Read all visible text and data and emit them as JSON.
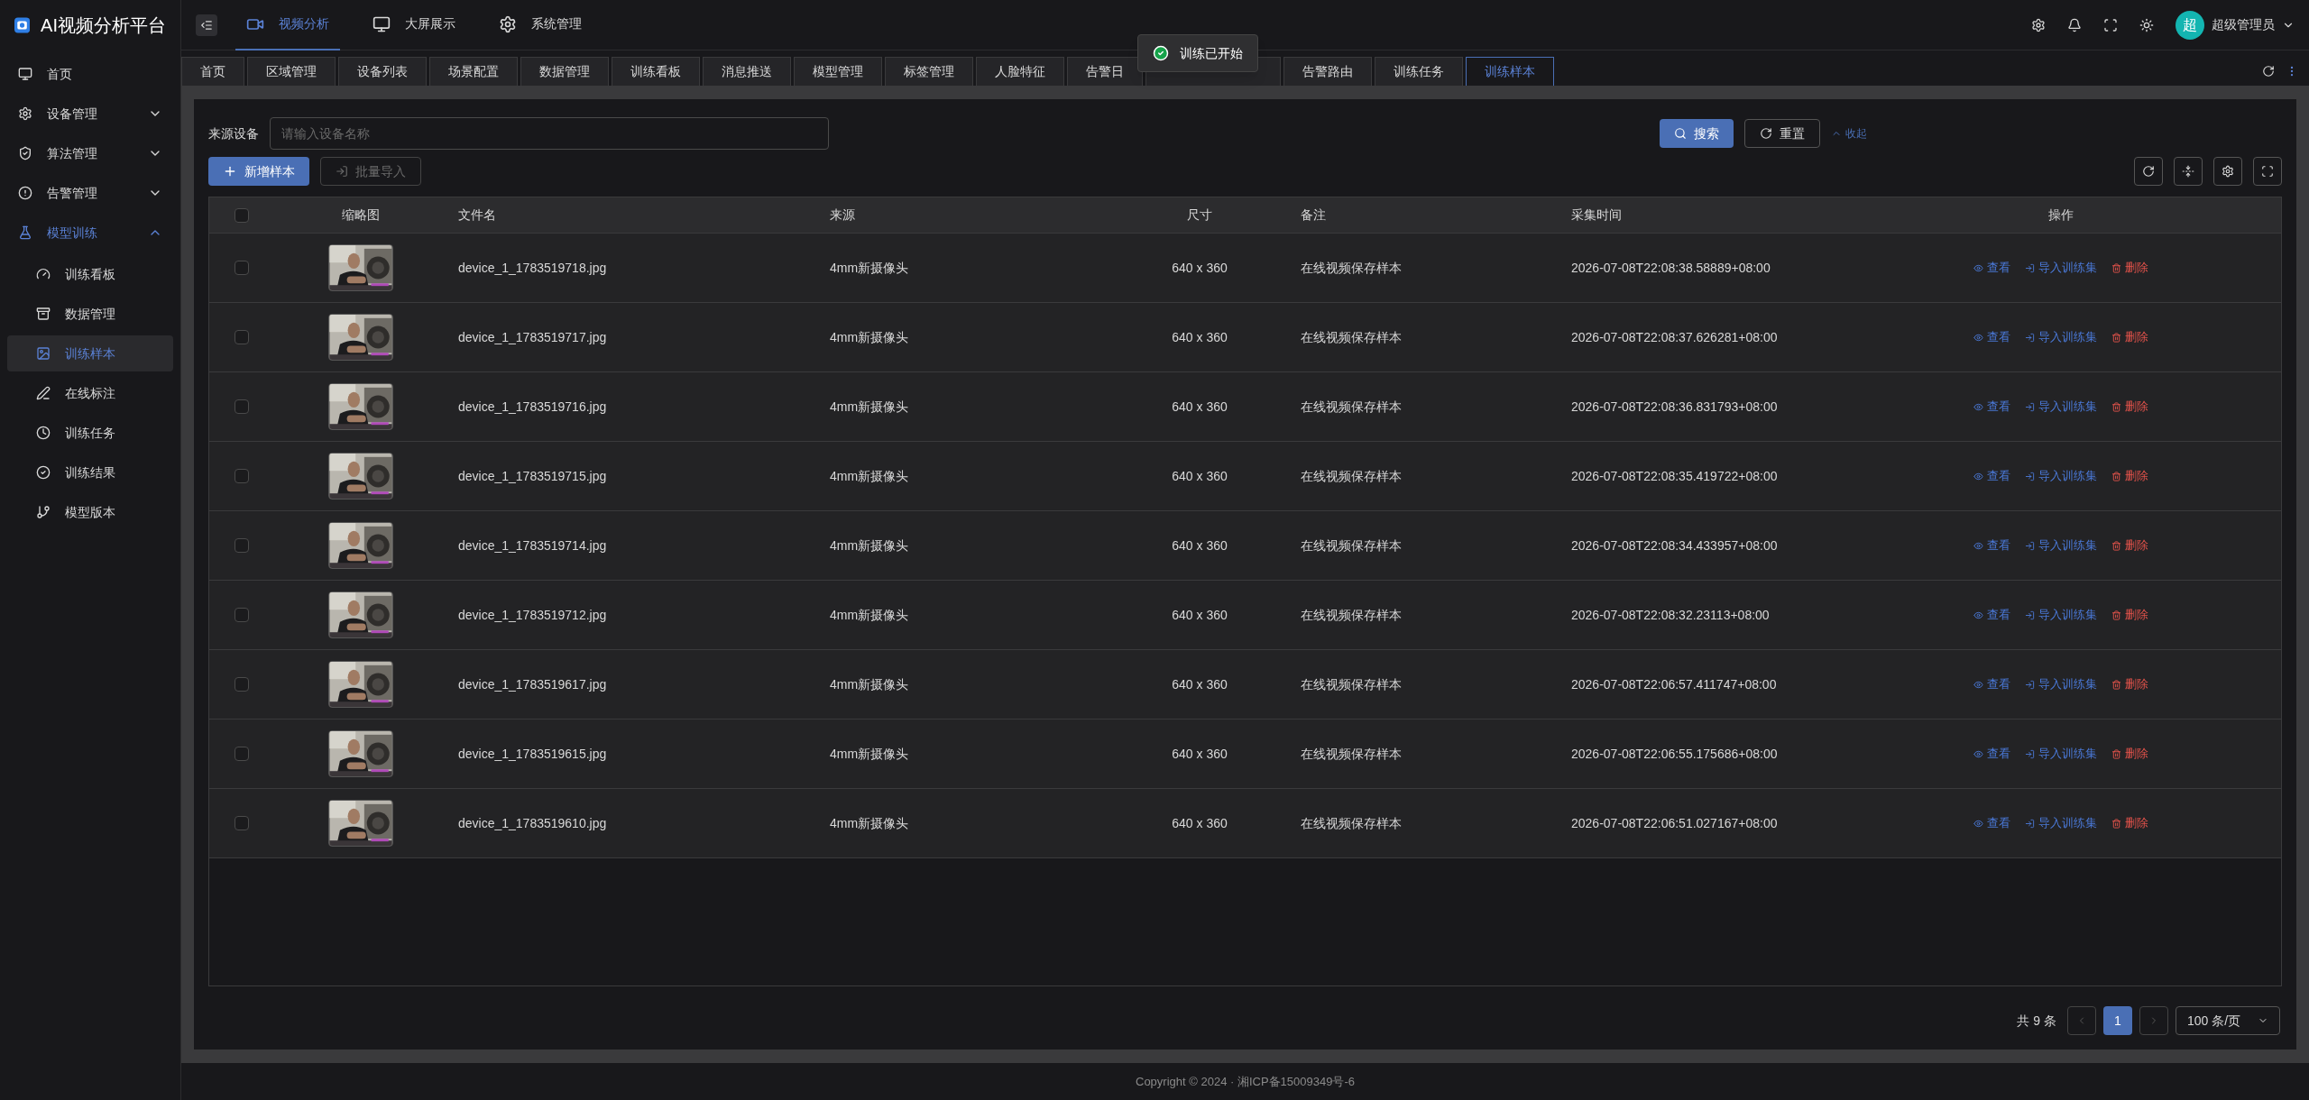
{
  "app": {
    "title": "AI视频分析平台"
  },
  "sidebar": {
    "items": [
      {
        "label": "首页",
        "selected": false
      },
      {
        "label": "设备管理",
        "selected": false,
        "expanded": false
      },
      {
        "label": "算法管理",
        "selected": false,
        "expanded": false
      },
      {
        "label": "告警管理",
        "selected": false,
        "expanded": false
      },
      {
        "label": "模型训练",
        "selected": true,
        "expanded": true,
        "children": [
          {
            "label": "训练看板",
            "selected": false
          },
          {
            "label": "数据管理",
            "selected": false
          },
          {
            "label": "训练样本",
            "selected": true
          },
          {
            "label": "在线标注",
            "selected": false
          },
          {
            "label": "训练任务",
            "selected": false
          },
          {
            "label": "训练结果",
            "selected": false
          },
          {
            "label": "模型版本",
            "selected": false
          }
        ]
      }
    ]
  },
  "top_nav": [
    {
      "label": "视频分析",
      "selected": true
    },
    {
      "label": "大屏展示",
      "selected": false
    },
    {
      "label": "系统管理",
      "selected": false
    }
  ],
  "user": {
    "avatar": "超",
    "name": "超级管理员"
  },
  "tabs": [
    {
      "label": "首页",
      "selected": false
    },
    {
      "label": "区域管理",
      "selected": false
    },
    {
      "label": "设备列表",
      "selected": false
    },
    {
      "label": "场景配置",
      "selected": false
    },
    {
      "label": "数据管理",
      "selected": false
    },
    {
      "label": "训练看板",
      "selected": false
    },
    {
      "label": "消息推送",
      "selected": false
    },
    {
      "label": "模型管理",
      "selected": false
    },
    {
      "label": "标签管理",
      "selected": false
    },
    {
      "label": "人脸特征",
      "selected": false
    },
    {
      "label": "告警日",
      "selected": false
    },
    {
      "selected": false
    },
    {
      "label": "告警路由",
      "selected": false
    },
    {
      "label": "训练任务",
      "selected": false
    },
    {
      "label": "训练样本",
      "selected": true
    }
  ],
  "toast": {
    "message": "训练已开始"
  },
  "filter": {
    "label": "来源设备",
    "placeholder": "请输入设备名称",
    "search": "搜索",
    "reset": "重置",
    "collapse": "收起"
  },
  "toolbar": {
    "add": "新增样本",
    "import": "批量导入",
    "import_disabled": true
  },
  "table": {
    "columns": [
      "缩略图",
      "文件名",
      "来源",
      "尺寸",
      "备注",
      "采集时间",
      "操作"
    ],
    "all_checked": false,
    "rows": [
      {
        "checked": false,
        "file": "device_1_1783519718.jpg",
        "source": "4mm新摄像头",
        "size": "640 x 360",
        "note": "在线视频保存样本",
        "time": "2026-07-08T22:08:38.58889+08:00"
      },
      {
        "checked": false,
        "file": "device_1_1783519717.jpg",
        "source": "4mm新摄像头",
        "size": "640 x 360",
        "note": "在线视频保存样本",
        "time": "2026-07-08T22:08:37.626281+08:00"
      },
      {
        "checked": false,
        "file": "device_1_1783519716.jpg",
        "source": "4mm新摄像头",
        "size": "640 x 360",
        "note": "在线视频保存样本",
        "time": "2026-07-08T22:08:36.831793+08:00"
      },
      {
        "checked": false,
        "file": "device_1_1783519715.jpg",
        "source": "4mm新摄像头",
        "size": "640 x 360",
        "note": "在线视频保存样本",
        "time": "2026-07-08T22:08:35.419722+08:00"
      },
      {
        "checked": false,
        "file": "device_1_1783519714.jpg",
        "source": "4mm新摄像头",
        "size": "640 x 360",
        "note": "在线视频保存样本",
        "time": "2026-07-08T22:08:34.433957+08:00"
      },
      {
        "checked": false,
        "file": "device_1_1783519712.jpg",
        "source": "4mm新摄像头",
        "size": "640 x 360",
        "note": "在线视频保存样本",
        "time": "2026-07-08T22:08:32.23113+08:00"
      },
      {
        "checked": false,
        "file": "device_1_1783519617.jpg",
        "source": "4mm新摄像头",
        "size": "640 x 360",
        "note": "在线视频保存样本",
        "time": "2026-07-08T22:06:57.411747+08:00"
      },
      {
        "checked": false,
        "file": "device_1_1783519615.jpg",
        "source": "4mm新摄像头",
        "size": "640 x 360",
        "note": "在线视频保存样本",
        "time": "2026-07-08T22:06:55.175686+08:00"
      },
      {
        "checked": false,
        "file": "device_1_1783519610.jpg",
        "source": "4mm新摄像头",
        "size": "640 x 360",
        "note": "在线视频保存样本",
        "time": "2026-07-08T22:06:51.027167+08:00"
      }
    ],
    "actions": [
      {
        "view": "查看",
        "import": "导入训练集",
        "delete": "删除"
      },
      {
        "view": "查看",
        "import": "导入训练集",
        "delete": "删除"
      },
      {
        "view": "查看",
        "import": "导入训练集",
        "delete": "删除"
      },
      {
        "view": "查看",
        "import": "导入训练集",
        "delete": "删除"
      },
      {
        "view": "查看",
        "import": "导入训练集",
        "delete": "删除"
      },
      {
        "view": "查看",
        "import": "导入训练集",
        "delete": "删除"
      },
      {
        "view": "查看",
        "import": "导入训练集",
        "delete": "删除"
      },
      {
        "view": "查看",
        "import": "导入训练集",
        "delete": "删除"
      },
      {
        "view": "查看",
        "import": "导入训练集",
        "delete": "删除"
      }
    ]
  },
  "pagination": {
    "total": "共 9 条",
    "pages": [
      {
        "label": "1",
        "selected": true
      }
    ],
    "page_size": "100 条/页"
  },
  "footer": {
    "text": "Copyright © 2024 · 湘ICP备15009349号-6"
  }
}
